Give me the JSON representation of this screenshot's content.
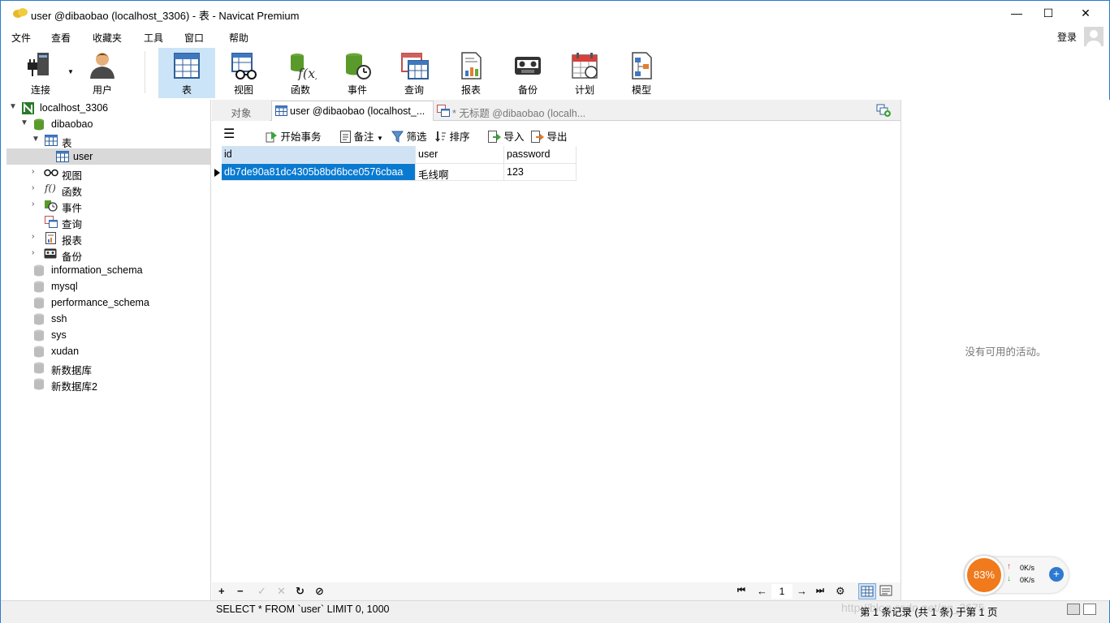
{
  "window": {
    "title": "user @dibaobao (localhost_3306) - 表 - Navicat Premium",
    "min_glyph": "—",
    "max_glyph": "☐",
    "close_glyph": "✕"
  },
  "menu": {
    "items": [
      "文件",
      "查看",
      "收藏夹",
      "工具",
      "窗口",
      "帮助"
    ],
    "login": "登录"
  },
  "toolbar": {
    "items": [
      {
        "label": "连接",
        "icon": "connection-icon"
      },
      {
        "label": "用户",
        "icon": "user-icon"
      },
      {
        "label": "表",
        "icon": "table-icon",
        "active": true
      },
      {
        "label": "视图",
        "icon": "view-icon"
      },
      {
        "label": "函数",
        "icon": "function-icon"
      },
      {
        "label": "事件",
        "icon": "event-icon"
      },
      {
        "label": "查询",
        "icon": "query-icon"
      },
      {
        "label": "报表",
        "icon": "report-icon"
      },
      {
        "label": "备份",
        "icon": "backup-icon"
      },
      {
        "label": "计划",
        "icon": "schedule-icon"
      },
      {
        "label": "模型",
        "icon": "model-icon"
      }
    ]
  },
  "tree": {
    "connection": "localhost_3306",
    "database": "dibaobao",
    "tables_group": "表",
    "table_user": "user",
    "views": "视图",
    "functions": "函数",
    "events": "事件",
    "queries": "查询",
    "reports": "报表",
    "backups": "备份",
    "other_databases": [
      "information_schema",
      "mysql",
      "performance_schema",
      "ssh",
      "sys",
      "xudan",
      "新数据库",
      "新数据库2"
    ]
  },
  "tabs": {
    "objects": "对象",
    "active": "user @dibaobao (localhost_...",
    "untitled": "* 无标题 @dibaobao (localh..."
  },
  "objtoolbar": {
    "begin_tx": "开始事务",
    "comment": "备注",
    "filter": "筛选",
    "sort": "排序",
    "import": "导入",
    "export": "导出"
  },
  "grid": {
    "columns": [
      "id",
      "user",
      "password"
    ],
    "rows": [
      [
        "db7de90a81dc4305b8bd6bce0576cbaa",
        "毛线啊",
        "123"
      ]
    ]
  },
  "navbar": {
    "add": "+",
    "remove": "−",
    "apply": "✓",
    "discard": "✕",
    "refresh": "↻",
    "stop": "⊘",
    "first": "⏮",
    "prev": "←",
    "page": "1",
    "next": "→",
    "last": "⏭",
    "settings": "⚙"
  },
  "rightpanel": {
    "no_activity": "没有可用的活动。"
  },
  "status": {
    "sql": "SELECT * FROM `user` LIMIT 0, 1000",
    "records": "第 1 条记录 (共 1 条) 于第 1 页",
    "watermark": "http://blog.csdn.net/qq_3675"
  },
  "speed_widget": {
    "percent": "83%",
    "up": "0K/s",
    "down": "0K/s"
  },
  "colors": {
    "selection": "#0a7ad1",
    "toolbar_active": "#cce4f7",
    "window_border": "#2b7bd1"
  }
}
